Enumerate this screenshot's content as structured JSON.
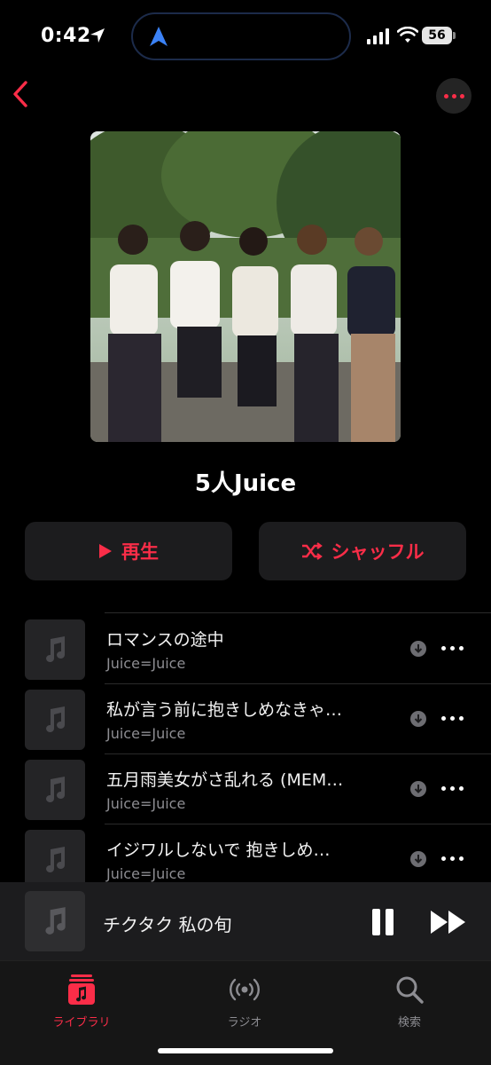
{
  "status_bar": {
    "time": "0:42",
    "battery": "56"
  },
  "album": {
    "title": "5人Juice"
  },
  "actions": {
    "play_label": "再生",
    "shuffle_label": "シャッフル"
  },
  "tracks": [
    {
      "title": "ロマンスの途中",
      "artist": "Juice=Juice"
    },
    {
      "title": "私が言う前に抱きしめなきゃ…",
      "artist": "Juice=Juice"
    },
    {
      "title": "五月雨美女がさ乱れる (MEM…",
      "artist": "Juice=Juice"
    },
    {
      "title": "イジワルしないで 抱きしめ…",
      "artist": "Juice=Juice"
    }
  ],
  "now_playing": {
    "title": "チクタク 私の旬"
  },
  "tabs": [
    {
      "label": "ライブラリ",
      "icon": "library-icon"
    },
    {
      "label": "ラジオ",
      "icon": "radio-icon"
    },
    {
      "label": "検索",
      "icon": "search-icon"
    }
  ],
  "colors": {
    "accent": "#fa2d48",
    "background": "#000000",
    "surface": "#1c1c1e"
  }
}
